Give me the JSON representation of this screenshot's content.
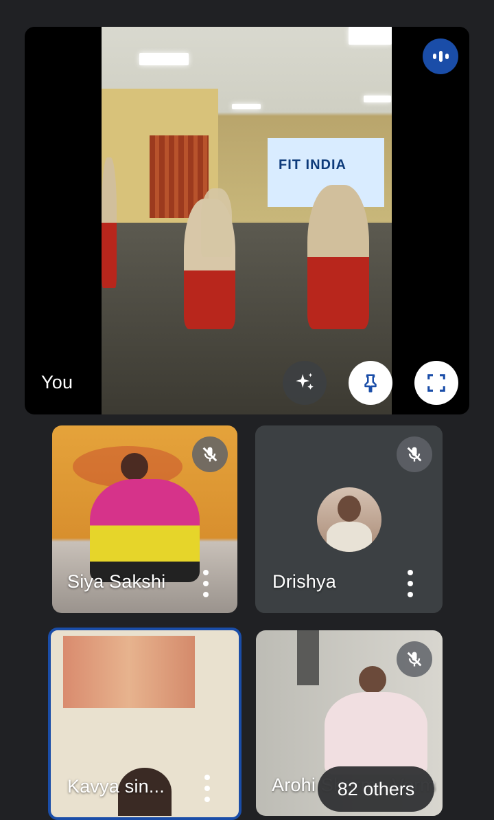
{
  "main_participant": {
    "name": "You",
    "screen_text": "FIT INDIA",
    "actions": {
      "effects_icon": "sparkle-icon",
      "pin_icon": "pin-icon",
      "fullscreen_icon": "fullscreen-icon",
      "speaking_icon": "audio-level-icon"
    }
  },
  "participants": [
    {
      "name": "Siya Sakshi",
      "muted": true
    },
    {
      "name": "Drishya",
      "muted": true
    },
    {
      "name": "Kavya sin...",
      "muted": false,
      "active_speaker": true
    },
    {
      "name": "Arohi Sharma Verma",
      "muted": true
    }
  ],
  "others": {
    "label": "82 others"
  },
  "colors": {
    "background": "#202124",
    "tile": "#3c4043",
    "accent": "#1a4da8"
  }
}
